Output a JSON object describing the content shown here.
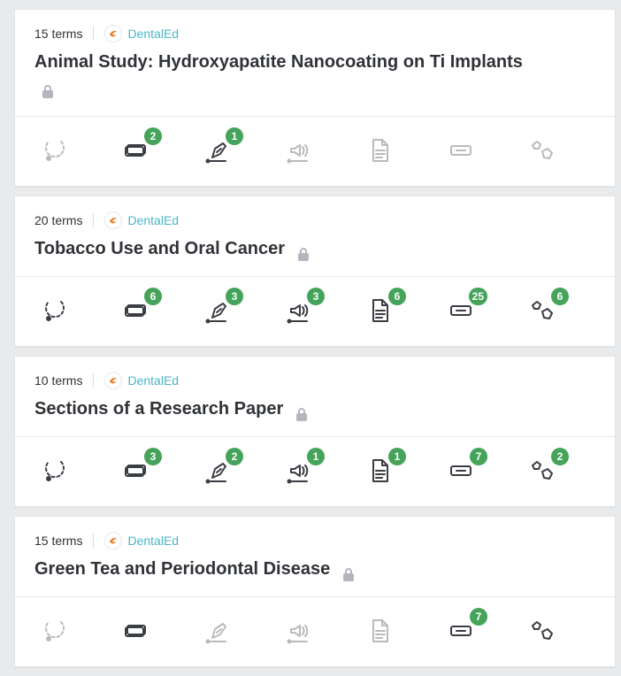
{
  "colors": {
    "background": "#e9eaec",
    "card": "#ffffff",
    "title": "#2f3237",
    "brand": "#4cb6c5",
    "badge": "#45a35a"
  },
  "cards": [
    {
      "terms": "15 terms",
      "brand": "DentalEd",
      "title": "Animal Study: Hydroxyapatite Nanocoating on Ti Implants",
      "lock_on_new_line": true,
      "items": [
        {
          "name": "loop-icon",
          "badge": "",
          "disabled": true
        },
        {
          "name": "flashcards-icon",
          "badge": "2",
          "disabled": false
        },
        {
          "name": "learn-pen-icon",
          "badge": "1",
          "disabled": false
        },
        {
          "name": "speller-icon",
          "badge": "",
          "disabled": true
        },
        {
          "name": "test-icon",
          "badge": "",
          "disabled": true
        },
        {
          "name": "match-icon",
          "badge": "",
          "disabled": true
        },
        {
          "name": "gravity-icon",
          "badge": "",
          "disabled": true
        }
      ]
    },
    {
      "terms": "20 terms",
      "brand": "DentalEd",
      "title": "Tobacco Use and Oral Cancer",
      "lock_on_new_line": false,
      "items": [
        {
          "name": "loop-icon",
          "badge": "",
          "disabled": false
        },
        {
          "name": "flashcards-icon",
          "badge": "6",
          "disabled": false
        },
        {
          "name": "learn-pen-icon",
          "badge": "3",
          "disabled": false
        },
        {
          "name": "speller-icon",
          "badge": "3",
          "disabled": false
        },
        {
          "name": "test-icon",
          "badge": "6",
          "disabled": false
        },
        {
          "name": "match-icon",
          "badge": "25",
          "disabled": false
        },
        {
          "name": "gravity-icon",
          "badge": "6",
          "disabled": false
        }
      ]
    },
    {
      "terms": "10 terms",
      "brand": "DentalEd",
      "title": "Sections of a Research Paper",
      "lock_on_new_line": false,
      "items": [
        {
          "name": "loop-icon",
          "badge": "",
          "disabled": false
        },
        {
          "name": "flashcards-icon",
          "badge": "3",
          "disabled": false
        },
        {
          "name": "learn-pen-icon",
          "badge": "2",
          "disabled": false
        },
        {
          "name": "speller-icon",
          "badge": "1",
          "disabled": false
        },
        {
          "name": "test-icon",
          "badge": "1",
          "disabled": false
        },
        {
          "name": "match-icon",
          "badge": "7",
          "disabled": false
        },
        {
          "name": "gravity-icon",
          "badge": "2",
          "disabled": false
        }
      ]
    },
    {
      "terms": "15 terms",
      "brand": "DentalEd",
      "title": "Green Tea and Periodontal Disease",
      "lock_on_new_line": false,
      "items": [
        {
          "name": "loop-icon",
          "badge": "",
          "disabled": true
        },
        {
          "name": "flashcards-icon",
          "badge": "",
          "disabled": false
        },
        {
          "name": "learn-pen-icon",
          "badge": "",
          "disabled": true
        },
        {
          "name": "speller-icon",
          "badge": "",
          "disabled": true
        },
        {
          "name": "test-icon",
          "badge": "",
          "disabled": true
        },
        {
          "name": "match-icon",
          "badge": "7",
          "disabled": false
        },
        {
          "name": "gravity-icon",
          "badge": "",
          "disabled": false
        }
      ]
    }
  ]
}
